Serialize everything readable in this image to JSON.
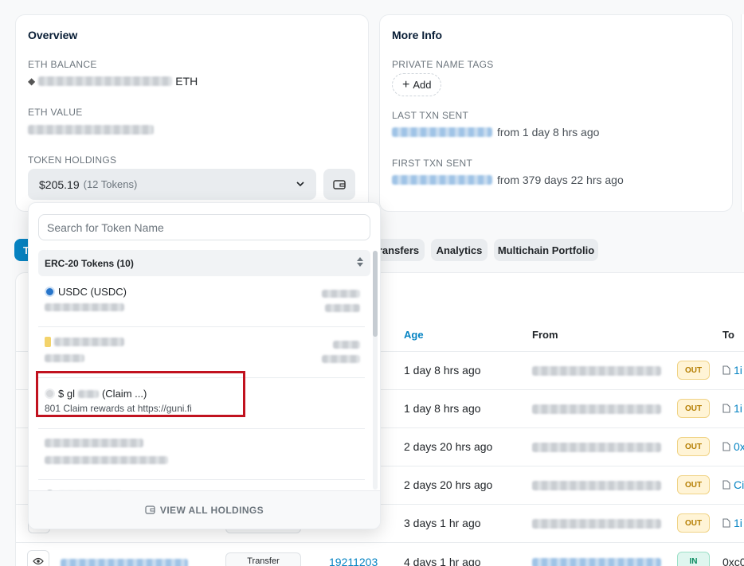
{
  "overview": {
    "title": "Overview",
    "eth_balance_label": "ETH BALANCE",
    "eth_balance_unit": "ETH",
    "eth_value_label": "ETH VALUE",
    "token_holdings_label": "TOKEN HOLDINGS",
    "token_holdings_value": "$205.19",
    "token_holdings_count": "(12 Tokens)"
  },
  "more_info": {
    "title": "More Info",
    "private_name_tags_label": "PRIVATE NAME TAGS",
    "add_label": "Add",
    "last_txn_label": "LAST TXN SENT",
    "last_txn_age": "from 1 day 8 hrs ago",
    "first_txn_label": "FIRST TXN SENT",
    "first_txn_age": "from 379 days 22 hrs ago"
  },
  "tabs": [
    {
      "label": "T",
      "active": true
    },
    {
      "label": "ransfers"
    },
    {
      "label": "Analytics"
    },
    {
      "label": "Multichain Portfolio"
    }
  ],
  "table": {
    "headers": {
      "age": "Age",
      "from": "From",
      "to": "To"
    },
    "rows": [
      {
        "age": "1 day 8 hrs ago",
        "dir": "OUT",
        "to": "1i"
      },
      {
        "age": "1 day 8 hrs ago",
        "dir": "OUT",
        "to": "1i"
      },
      {
        "age": "2 days 20 hrs ago",
        "dir": "OUT",
        "to": "0x"
      },
      {
        "age": "2 days 20 hrs ago",
        "dir": "OUT",
        "to": "Ci"
      },
      {
        "age": "3 days 1 hr ago",
        "dir": "OUT",
        "to": "1i"
      },
      {
        "age": "4 days 1 hr ago",
        "dir": "IN",
        "to": "0xc0",
        "method": "Transfer",
        "block": "19211203"
      }
    ]
  },
  "dropdown": {
    "search_placeholder": "Search for Token Name",
    "group_label": "ERC-20 Tokens (10)",
    "items": [
      {
        "name": "USDC (USDC)"
      },
      {
        "name": ""
      },
      {
        "name_prefix": "$ gl",
        "name_suffix": "(Claim ...)",
        "sub": "801 Claim rewards at https://guni.fi"
      },
      {
        "name": ""
      },
      {
        "name": ""
      }
    ],
    "footer_label": "VIEW ALL HOLDINGS"
  },
  "colors": {
    "accent": "#0784c3",
    "highlight_border": "#c1121f",
    "out_badge": "#fff4d6",
    "in_badge": "#dff6ef"
  }
}
